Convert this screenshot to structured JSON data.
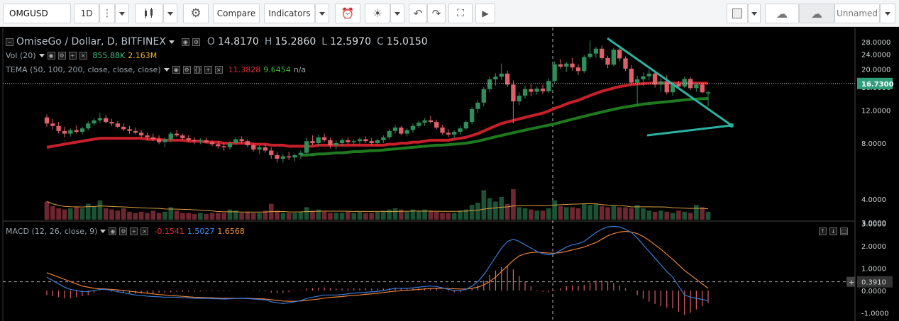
{
  "toolbar": {
    "symbol": "OMGUSD",
    "interval": "1D",
    "compare_label": "Compare",
    "indicators_label": "Indicators",
    "layout_name": "Unnamed"
  },
  "legend": {
    "main": {
      "title": "OmiseGo / Dollar, D, BITFINEX",
      "o_key": "O",
      "o": "14.8170",
      "h_key": "H",
      "h": "15.2860",
      "l_key": "L",
      "l": "12.5970",
      "c_key": "C",
      "c": "15.0150"
    },
    "vol": {
      "label": "Vol (20)",
      "v1": "855.88K",
      "v2": "2.163M"
    },
    "tema": {
      "label": "TEMA (50, 100, 200, close, close, close)",
      "v1": "11.3828",
      "v2": "9.6454",
      "v3": "n/a"
    },
    "macd": {
      "label": "MACD (12, 26, close, 9)",
      "hist": "-0.1541",
      "macd": "1.5027",
      "signal": "1.6568"
    }
  },
  "colors": {
    "up": "#2f8f5a",
    "down": "#e0606a",
    "tema1": "#c8202a",
    "tema2": "#1f7a1f",
    "triangle": "#2bb3a0",
    "macd_line": "#3a7bd5",
    "signal_line": "#e8823a",
    "hist": "#e0606a",
    "price_badge": "#2f9e7a"
  },
  "chart_data": [
    {
      "type": "candlestick",
      "title": "OmiseGo / Dollar, D, BITFINEX",
      "y_axis": {
        "scale": "log",
        "ticks": [
          "28.0000",
          "24.0000",
          "20.0000",
          "16.0000",
          "12.0000",
          "8.0000",
          "4.0000",
          "3.0000"
        ]
      },
      "last_price": "16.7300",
      "candles_ohlc": [
        [
          11.0,
          11.4,
          9.8,
          10.2
        ],
        [
          10.2,
          10.8,
          9.5,
          9.9
        ],
        [
          9.9,
          10.4,
          9.0,
          9.3
        ],
        [
          9.3,
          9.8,
          8.6,
          9.0
        ],
        [
          9.0,
          9.6,
          8.7,
          9.4
        ],
        [
          9.4,
          9.9,
          9.0,
          9.2
        ],
        [
          9.2,
          9.8,
          8.9,
          9.6
        ],
        [
          9.6,
          10.5,
          9.4,
          10.2
        ],
        [
          10.2,
          10.9,
          9.9,
          10.6
        ],
        [
          10.6,
          11.6,
          10.3,
          10.9
        ],
        [
          10.9,
          11.3,
          10.2,
          10.4
        ],
        [
          10.4,
          10.8,
          9.9,
          10.2
        ],
        [
          10.2,
          10.5,
          9.6,
          9.8
        ],
        [
          9.8,
          10.2,
          9.3,
          9.5
        ],
        [
          9.5,
          9.9,
          9.0,
          9.3
        ],
        [
          9.3,
          9.7,
          8.9,
          9.1
        ],
        [
          9.1,
          9.4,
          8.6,
          8.8
        ],
        [
          8.8,
          9.1,
          8.3,
          8.6
        ],
        [
          8.6,
          9.0,
          8.2,
          8.4
        ],
        [
          8.4,
          8.8,
          7.9,
          8.1
        ],
        [
          8.1,
          8.6,
          7.6,
          8.4
        ],
        [
          8.4,
          9.2,
          8.1,
          9.0
        ],
        [
          9.0,
          9.4,
          8.6,
          8.8
        ],
        [
          8.8,
          9.0,
          8.3,
          8.5
        ],
        [
          8.5,
          8.8,
          8.1,
          8.3
        ],
        [
          8.3,
          8.6,
          7.9,
          8.2
        ],
        [
          8.2,
          8.5,
          7.9,
          8.3
        ],
        [
          8.3,
          8.6,
          8.0,
          8.1
        ],
        [
          8.1,
          8.3,
          7.7,
          7.9
        ],
        [
          7.9,
          8.2,
          7.5,
          7.7
        ],
        [
          7.7,
          8.0,
          7.3,
          7.6
        ],
        [
          7.6,
          8.2,
          7.4,
          8.0
        ],
        [
          8.0,
          8.6,
          7.8,
          8.4
        ],
        [
          8.4,
          8.7,
          8.0,
          8.2
        ],
        [
          8.2,
          8.4,
          7.6,
          7.8
        ],
        [
          7.8,
          8.0,
          7.2,
          7.4
        ],
        [
          7.4,
          7.8,
          7.0,
          7.6
        ],
        [
          7.6,
          7.9,
          7.1,
          7.3
        ],
        [
          7.3,
          7.6,
          6.6,
          6.9
        ],
        [
          6.9,
          7.2,
          6.3,
          6.6
        ],
        [
          6.6,
          7.0,
          6.3,
          6.8
        ],
        [
          6.8,
          7.2,
          6.5,
          6.7
        ],
        [
          6.7,
          7.0,
          6.4,
          6.9
        ],
        [
          6.9,
          7.3,
          6.6,
          7.1
        ],
        [
          7.1,
          8.6,
          6.9,
          8.2
        ],
        [
          8.2,
          8.8,
          7.8,
          8.0
        ],
        [
          8.0,
          8.9,
          7.7,
          8.6
        ],
        [
          8.6,
          9.0,
          8.1,
          8.3
        ],
        [
          8.3,
          8.6,
          7.5,
          7.8
        ],
        [
          7.8,
          8.3,
          7.4,
          8.0
        ],
        [
          8.0,
          8.5,
          7.7,
          8.3
        ],
        [
          8.3,
          8.6,
          7.9,
          8.1
        ],
        [
          8.1,
          8.4,
          7.8,
          8.2
        ],
        [
          8.2,
          8.6,
          7.9,
          8.4
        ],
        [
          8.4,
          8.7,
          8.0,
          8.2
        ],
        [
          8.2,
          8.5,
          7.8,
          8.0
        ],
        [
          8.0,
          8.4,
          7.7,
          8.3
        ],
        [
          8.3,
          8.8,
          8.0,
          8.6
        ],
        [
          8.6,
          9.5,
          8.4,
          9.3
        ],
        [
          9.3,
          10.0,
          9.0,
          9.7
        ],
        [
          9.7,
          9.9,
          8.8,
          9.0
        ],
        [
          9.0,
          9.6,
          8.7,
          9.4
        ],
        [
          9.4,
          10.2,
          9.1,
          9.9
        ],
        [
          9.9,
          10.6,
          9.6,
          10.3
        ],
        [
          10.3,
          10.9,
          9.9,
          10.6
        ],
        [
          10.6,
          11.2,
          10.2,
          10.4
        ],
        [
          10.4,
          10.7,
          9.5,
          9.7
        ],
        [
          9.7,
          10.0,
          8.9,
          9.1
        ],
        [
          9.1,
          9.5,
          8.6,
          8.9
        ],
        [
          8.9,
          9.4,
          8.5,
          9.2
        ],
        [
          9.2,
          9.9,
          8.9,
          9.6
        ],
        [
          9.6,
          10.6,
          9.4,
          10.4
        ],
        [
          10.4,
          12.5,
          10.1,
          12.2
        ],
        [
          12.2,
          13.6,
          11.6,
          13.2
        ],
        [
          13.2,
          16.0,
          12.6,
          15.6
        ],
        [
          15.6,
          18.2,
          15.0,
          17.6
        ],
        [
          17.6,
          19.0,
          16.3,
          18.2
        ],
        [
          18.2,
          21.4,
          17.5,
          18.9
        ],
        [
          18.9,
          19.6,
          16.0,
          16.5
        ],
        [
          16.5,
          17.4,
          10.2,
          13.4
        ],
        [
          13.4,
          15.0,
          12.8,
          14.4
        ],
        [
          14.4,
          16.2,
          13.9,
          15.6
        ],
        [
          15.6,
          16.6,
          14.3,
          15.1
        ],
        [
          15.1,
          16.1,
          14.6,
          15.7
        ],
        [
          15.7,
          16.5,
          14.7,
          15.2
        ],
        [
          15.2,
          17.8,
          14.9,
          17.3
        ],
        [
          17.3,
          22.0,
          16.9,
          21.2
        ],
        [
          21.2,
          22.6,
          20.0,
          20.6
        ],
        [
          20.6,
          21.8,
          19.3,
          21.4
        ],
        [
          21.4,
          22.9,
          19.6,
          20.4
        ],
        [
          20.4,
          21.2,
          18.6,
          19.5
        ],
        [
          19.5,
          23.8,
          19.0,
          23.2
        ],
        [
          23.2,
          28.4,
          22.6,
          24.2
        ],
        [
          24.2,
          26.3,
          23.0,
          25.7
        ],
        [
          25.7,
          26.7,
          22.3,
          22.9
        ],
        [
          22.9,
          23.6,
          20.2,
          21.1
        ],
        [
          21.1,
          26.0,
          20.7,
          25.4
        ],
        [
          25.4,
          25.9,
          22.0,
          22.8
        ],
        [
          22.8,
          23.4,
          19.5,
          20.1
        ],
        [
          20.1,
          21.0,
          16.4,
          16.9
        ],
        [
          16.9,
          18.4,
          12.6,
          17.6
        ],
        [
          17.6,
          19.2,
          16.2,
          18.3
        ],
        [
          18.3,
          19.8,
          17.4,
          18.9
        ],
        [
          18.9,
          19.3,
          15.9,
          16.5
        ],
        [
          16.5,
          17.9,
          15.1,
          17.2
        ],
        [
          17.2,
          18.5,
          14.6,
          15.0
        ],
        [
          15.0,
          17.1,
          14.4,
          16.6
        ],
        [
          16.6,
          17.3,
          15.6,
          16.1
        ],
        [
          16.1,
          18.2,
          15.8,
          17.7
        ],
        [
          17.7,
          18.1,
          15.4,
          15.8
        ],
        [
          15.8,
          16.9,
          15.1,
          16.5
        ],
        [
          16.5,
          16.9,
          14.8,
          15.0
        ],
        [
          14.8,
          15.3,
          12.6,
          15.0
        ]
      ],
      "volume_rel": [
        0.8,
        0.6,
        0.5,
        0.45,
        0.5,
        0.55,
        0.5,
        0.7,
        0.6,
        0.85,
        0.5,
        0.45,
        0.4,
        0.5,
        0.35,
        0.3,
        0.35,
        0.3,
        0.4,
        0.3,
        0.35,
        0.55,
        0.4,
        0.3,
        0.3,
        0.25,
        0.3,
        0.25,
        0.3,
        0.3,
        0.3,
        0.45,
        0.4,
        0.3,
        0.35,
        0.3,
        0.3,
        0.4,
        0.7,
        0.4,
        0.3,
        0.3,
        0.3,
        0.35,
        0.55,
        0.4,
        0.45,
        0.35,
        0.3,
        0.3,
        0.3,
        0.35,
        0.3,
        0.35,
        0.3,
        0.3,
        0.35,
        0.4,
        0.45,
        0.5,
        0.45,
        0.35,
        0.45,
        0.4,
        0.45,
        0.4,
        0.35,
        0.3,
        0.3,
        0.3,
        0.4,
        0.45,
        0.65,
        0.75,
        1.3,
        0.95,
        0.8,
        1.0,
        0.7,
        1.35,
        0.55,
        0.5,
        0.45,
        0.4,
        0.4,
        0.5,
        0.85,
        0.6,
        0.55,
        0.55,
        0.5,
        0.7,
        0.65,
        0.7,
        0.6,
        0.55,
        0.6,
        0.55,
        0.55,
        0.5,
        0.65,
        0.5,
        0.4,
        0.35,
        0.4,
        0.35,
        0.3,
        0.4,
        0.35,
        0.3,
        0.65,
        0.55,
        0.35
      ],
      "tema_50": [
        7.6,
        7.7,
        7.8,
        7.9,
        8.0,
        8.1,
        8.2,
        8.3,
        8.4,
        8.5,
        8.5,
        8.5,
        8.5,
        8.5,
        8.5,
        8.5,
        8.5,
        8.4,
        8.4,
        8.4,
        8.3,
        8.3,
        8.3,
        8.3,
        8.2,
        8.2,
        8.2,
        8.1,
        8.1,
        8.1,
        8.0,
        8.0,
        8.0,
        8.0,
        8.0,
        7.9,
        7.9,
        7.9,
        7.8,
        7.8,
        7.8,
        7.7,
        7.7,
        7.7,
        7.7,
        7.7,
        7.8,
        7.8,
        7.8,
        7.8,
        7.8,
        7.8,
        7.8,
        7.8,
        7.8,
        7.8,
        7.8,
        7.8,
        7.9,
        7.9,
        8.0,
        8.0,
        8.1,
        8.1,
        8.2,
        8.3,
        8.3,
        8.3,
        8.3,
        8.4,
        8.5,
        8.6,
        8.8,
        9.0,
        9.3,
        9.6,
        9.9,
        10.2,
        10.4,
        10.6,
        10.8,
        11.0,
        11.2,
        11.4,
        11.6,
        11.9,
        12.3,
        12.6,
        13.0,
        13.3,
        13.6,
        14.0,
        14.4,
        14.8,
        15.2,
        15.5,
        15.8,
        16.1,
        16.3,
        16.5,
        16.6,
        16.7,
        16.8,
        16.8,
        16.8,
        16.8,
        16.8,
        16.8,
        16.8,
        16.8,
        16.8,
        16.8,
        16.8
      ],
      "tema_100": [
        null,
        null,
        null,
        null,
        null,
        null,
        null,
        null,
        null,
        null,
        null,
        null,
        null,
        null,
        null,
        null,
        null,
        null,
        null,
        null,
        null,
        null,
        null,
        null,
        null,
        null,
        null,
        null,
        null,
        null,
        null,
        null,
        null,
        null,
        null,
        null,
        null,
        null,
        null,
        null,
        null,
        null,
        null,
        6.9,
        6.9,
        6.95,
        7.0,
        7.0,
        7.05,
        7.1,
        7.1,
        7.15,
        7.2,
        7.2,
        7.25,
        7.3,
        7.3,
        7.35,
        7.4,
        7.45,
        7.5,
        7.55,
        7.6,
        7.65,
        7.7,
        7.75,
        7.8,
        7.8,
        7.85,
        7.9,
        7.95,
        8.0,
        8.1,
        8.2,
        8.35,
        8.5,
        8.65,
        8.8,
        8.95,
        9.1,
        9.25,
        9.4,
        9.55,
        9.7,
        9.85,
        10.0,
        10.15,
        10.35,
        10.55,
        10.75,
        10.95,
        11.15,
        11.35,
        11.55,
        11.75,
        11.95,
        12.15,
        12.35,
        12.5,
        12.65,
        12.8,
        12.95,
        13.05,
        13.15,
        13.25,
        13.35,
        13.45,
        13.55,
        13.65,
        13.75,
        13.8,
        13.85,
        13.9
      ]
    },
    {
      "type": "line",
      "title": "MACD (12, 26, close, 9)",
      "y_axis": {
        "ticks": [
          "3.0000",
          "2.0000",
          "1.0000",
          "0.0000",
          "-1.0000"
        ]
      },
      "current_value_label": "0.3910",
      "macd": [
        0.6,
        0.45,
        0.3,
        0.15,
        0.05,
        0.0,
        -0.05,
        -0.05,
        0.0,
        0.05,
        0.05,
        0.0,
        -0.05,
        -0.1,
        -0.15,
        -0.2,
        -0.22,
        -0.25,
        -0.27,
        -0.28,
        -0.3,
        -0.3,
        -0.3,
        -0.32,
        -0.33,
        -0.35,
        -0.35,
        -0.35,
        -0.36,
        -0.37,
        -0.38,
        -0.37,
        -0.35,
        -0.35,
        -0.36,
        -0.38,
        -0.4,
        -0.42,
        -0.5,
        -0.55,
        -0.58,
        -0.55,
        -0.5,
        -0.45,
        -0.35,
        -0.3,
        -0.25,
        -0.2,
        -0.2,
        -0.2,
        -0.18,
        -0.15,
        -0.12,
        -0.1,
        -0.08,
        -0.06,
        -0.04,
        0.0,
        0.05,
        0.1,
        0.1,
        0.1,
        0.12,
        0.15,
        0.18,
        0.2,
        0.18,
        0.12,
        0.05,
        0.0,
        0.0,
        0.05,
        0.2,
        0.4,
        0.7,
        1.1,
        1.5,
        1.9,
        2.2,
        2.3,
        2.2,
        2.05,
        1.9,
        1.75,
        1.65,
        1.6,
        1.65,
        1.8,
        1.95,
        2.05,
        2.1,
        2.2,
        2.4,
        2.6,
        2.75,
        2.85,
        2.88,
        2.85,
        2.75,
        2.6,
        2.35,
        2.05,
        1.75,
        1.45,
        1.15,
        0.85,
        0.6,
        0.2,
        -0.2,
        -0.3,
        -0.35,
        -0.4,
        -0.45
      ],
      "signal": [
        0.8,
        0.7,
        0.6,
        0.5,
        0.4,
        0.3,
        0.2,
        0.15,
        0.1,
        0.08,
        0.07,
        0.05,
        0.03,
        0.0,
        -0.03,
        -0.06,
        -0.09,
        -0.12,
        -0.15,
        -0.18,
        -0.2,
        -0.22,
        -0.24,
        -0.26,
        -0.28,
        -0.3,
        -0.31,
        -0.32,
        -0.33,
        -0.34,
        -0.35,
        -0.35,
        -0.35,
        -0.35,
        -0.35,
        -0.36,
        -0.37,
        -0.38,
        -0.41,
        -0.44,
        -0.47,
        -0.48,
        -0.48,
        -0.47,
        -0.44,
        -0.41,
        -0.38,
        -0.34,
        -0.31,
        -0.29,
        -0.27,
        -0.24,
        -0.22,
        -0.2,
        -0.17,
        -0.15,
        -0.12,
        -0.09,
        -0.06,
        -0.03,
        -0.01,
        0.01,
        0.03,
        0.05,
        0.07,
        0.09,
        0.1,
        0.1,
        0.09,
        0.08,
        0.07,
        0.07,
        0.1,
        0.15,
        0.25,
        0.4,
        0.6,
        0.85,
        1.1,
        1.35,
        1.55,
        1.65,
        1.7,
        1.72,
        1.7,
        1.68,
        1.67,
        1.7,
        1.75,
        1.82,
        1.88,
        1.95,
        2.05,
        2.15,
        2.3,
        2.45,
        2.55,
        2.62,
        2.65,
        2.62,
        2.55,
        2.42,
        2.25,
        2.05,
        1.85,
        1.62,
        1.4,
        1.15,
        0.9,
        0.7,
        0.5,
        0.3,
        0.1
      ]
    }
  ]
}
